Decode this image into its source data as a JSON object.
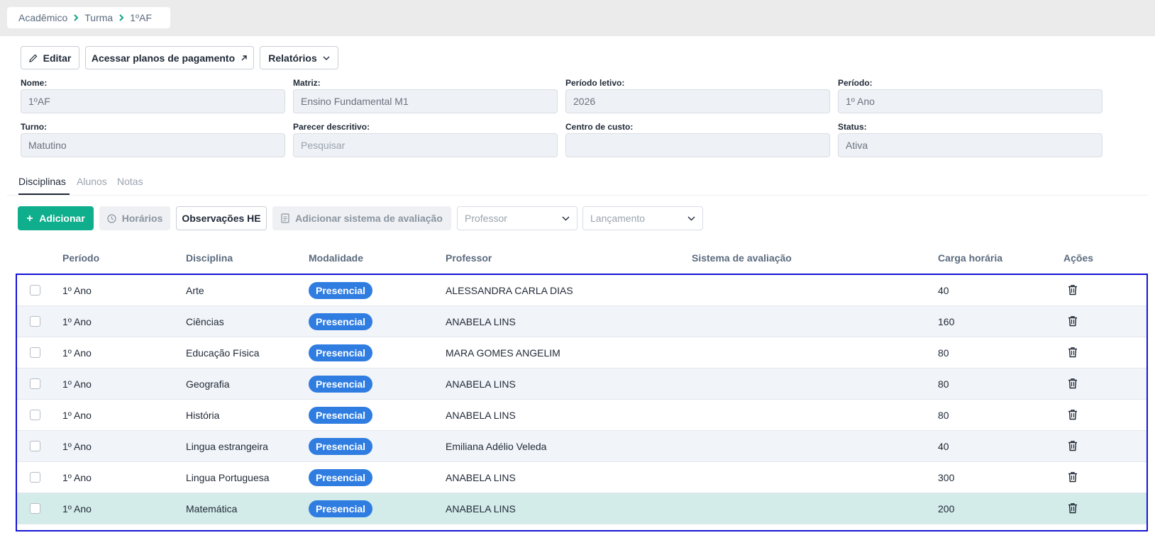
{
  "breadcrumb": {
    "items": [
      "Acadêmico",
      "Turma",
      "1ºAF"
    ]
  },
  "actions": {
    "edit": "Editar",
    "payment_plans": "Acessar planos de pagamento",
    "reports": "Relatórios"
  },
  "form": {
    "nome": {
      "label": "Nome:",
      "value": "1ºAF"
    },
    "matriz": {
      "label": "Matriz:",
      "value": "Ensino Fundamental M1"
    },
    "periodo_letivo": {
      "label": "Período letivo:",
      "value": "2026"
    },
    "periodo": {
      "label": "Período:",
      "value": "1º Ano"
    },
    "turno": {
      "label": "Turno:",
      "value": "Matutino"
    },
    "parecer": {
      "label": "Parecer descritivo:",
      "placeholder": "Pesquisar"
    },
    "centro_custo": {
      "label": "Centro de custo:",
      "value": ""
    },
    "status": {
      "label": "Status:",
      "value": "Ativa"
    }
  },
  "tabs": [
    "Disciplinas",
    "Alunos",
    "Notas"
  ],
  "toolbar": {
    "add": "Adicionar",
    "schedules": "Horários",
    "observations": "Observações HE",
    "add_evaluation": "Adicionar sistema de avaliação",
    "professor_placeholder": "Professor",
    "launch_placeholder": "Lançamento"
  },
  "table": {
    "columns": [
      "Período",
      "Disciplina",
      "Modalidade",
      "Professor",
      "Sistema de avaliação",
      "Carga horária",
      "Ações"
    ],
    "rows": [
      {
        "periodo": "1º Ano",
        "disciplina": "Arte",
        "modalidade": "Presencial",
        "professor": "ALESSANDRA CARLA DIAS",
        "sistema": "",
        "carga": "40"
      },
      {
        "periodo": "1º Ano",
        "disciplina": "Ciências",
        "modalidade": "Presencial",
        "professor": "ANABELA LINS",
        "sistema": "",
        "carga": "160"
      },
      {
        "periodo": "1º Ano",
        "disciplina": "Educação Física",
        "modalidade": "Presencial",
        "professor": "MARA GOMES ANGELIM",
        "sistema": "",
        "carga": "80"
      },
      {
        "periodo": "1º Ano",
        "disciplina": "Geografia",
        "modalidade": "Presencial",
        "professor": "ANABELA LINS",
        "sistema": "",
        "carga": "80"
      },
      {
        "periodo": "1º Ano",
        "disciplina": "História",
        "modalidade": "Presencial",
        "professor": "ANABELA LINS",
        "sistema": "",
        "carga": "80"
      },
      {
        "periodo": "1º Ano",
        "disciplina": "Lingua estrangeira",
        "modalidade": "Presencial",
        "professor": "Emiliana Adélio Veleda",
        "sistema": "",
        "carga": "40"
      },
      {
        "periodo": "1º Ano",
        "disciplina": "Lingua Portuguesa",
        "modalidade": "Presencial",
        "professor": "ANABELA LINS",
        "sistema": "",
        "carga": "300"
      },
      {
        "periodo": "1º Ano",
        "disciplina": "Matemática",
        "modalidade": "Presencial",
        "professor": "ANABELA LINS",
        "sistema": "",
        "carga": "200"
      }
    ]
  },
  "colors": {
    "primary": "#0fae8c",
    "badge": "#2f7de1",
    "row_alt": "#f1f4f8",
    "row_highlight": "#d3ebe9",
    "selection_frame": "#1414d6"
  }
}
